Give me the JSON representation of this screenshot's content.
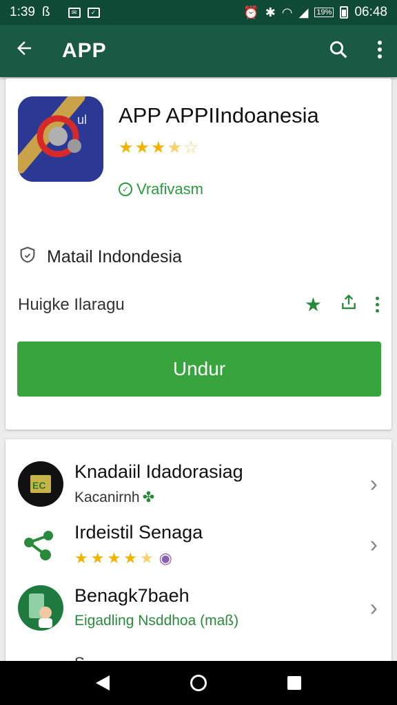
{
  "status_bar": {
    "time_left": "1:39",
    "glyph_left": "ß",
    "time_right": "06:48",
    "battery_label": "19%",
    "icons": [
      "notification-box-icon",
      "notification-box-icon",
      "alarm-icon",
      "bluetooth-icon",
      "wifi-icon",
      "signal-icon",
      "battery-icon"
    ]
  },
  "app_bar": {
    "title": "APP",
    "icons": [
      "back-arrow-icon",
      "search-icon",
      "more-vert-icon"
    ]
  },
  "app": {
    "title": "APP APPIIndoanesia",
    "rating_stars": 3.5,
    "verified_label": "Vrafivasm",
    "developer": "Matail Indondesia",
    "meta_text": "Huigke Ilaragu",
    "install_label": "Undur"
  },
  "related": [
    {
      "title": "Knadaiil Idadorasiag",
      "subtitle": "Kacanirnh",
      "icon": "app-icon-green-yellow"
    },
    {
      "title": "Irdeistil Senaga",
      "stars": 4,
      "icon": "share-nodes-icon"
    },
    {
      "title": "Benagk7baeh",
      "subtitle": "Eigadling Nsddhoa (maß)",
      "icon": "avatar-phone-icon"
    }
  ],
  "partial_item_text": "S",
  "colors": {
    "status_bar": "#0f4a36",
    "app_bar": "#1a5a44",
    "accent_green": "#37a43d",
    "star": "#f2b300"
  }
}
